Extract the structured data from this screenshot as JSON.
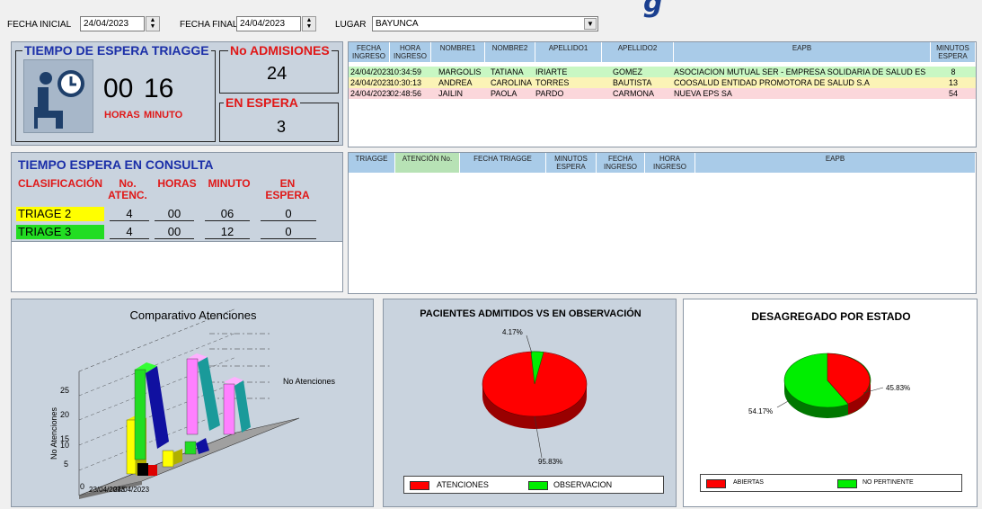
{
  "filters": {
    "fecha_inicial_label": "FECHA INICIAL",
    "fecha_inicial_value": "24/04/2023",
    "fecha_final_label": "FECHA FINAL",
    "fecha_final_value": "24/04/2023",
    "lugar_label": "LUGAR",
    "lugar_value": "BAYUNCA"
  },
  "wait_triage": {
    "title": "TIEMPO DE ESPERA TRIAGGE",
    "hours": "00",
    "minutes": "16",
    "hours_label": "HORAS",
    "minutes_label": "MINUTO"
  },
  "admissions": {
    "title": "No ADMISIONES",
    "value": "24"
  },
  "waiting": {
    "title": "EN ESPERA",
    "value": "3"
  },
  "waiting_table": {
    "headers": [
      "FECHA INGRESO",
      "HORA INGRESO",
      "NOMBRE1",
      "NOMBRE2",
      "APELLIDO1",
      "APELLIDO2",
      "EAPB",
      "MINUTOS ESPERA"
    ],
    "rows": [
      {
        "fecha": "24/04/2023",
        "hora": "10:34:59",
        "nombre1": "MARGOLIS",
        "nombre2": "TATIANA",
        "apellido1": "IRIARTE",
        "apellido2": "GOMEZ",
        "eapb": "ASOCIACION MUTUAL SER - EMPRESA SOLIDARIA DE SALUD ES",
        "minutos": "8",
        "color": "#c8f7c3"
      },
      {
        "fecha": "24/04/2023",
        "hora": "10:30:13",
        "nombre1": "ANDREA",
        "nombre2": "CAROLINA",
        "apellido1": "TORRES",
        "apellido2": "BAUTISTA",
        "eapb": "COOSALUD ENTIDAD PROMOTORA DE SALUD S.A",
        "minutos": "13",
        "color": "#fbf3b6"
      },
      {
        "fecha": "24/04/2023",
        "hora": "02:48:56",
        "nombre1": "JAILIN",
        "nombre2": "PAOLA",
        "apellido1": "PARDO",
        "apellido2": "CARMONA",
        "eapb": "NUEVA EPS SA",
        "minutos": "54",
        "color": "#fbd7db"
      }
    ]
  },
  "consult": {
    "title": "TIEMPO ESPERA EN CONSULTA",
    "headers": [
      "CLASIFICACIÓN",
      "No. ATENC.",
      "HORAS",
      "MINUTO",
      "EN ESPERA"
    ],
    "rows": [
      {
        "name": "TRIAGE 2",
        "aten": "4",
        "horas": "00",
        "minuto": "06",
        "espera": "0",
        "color": "#ffff00"
      },
      {
        "name": "TRIAGE 3",
        "aten": "4",
        "horas": "00",
        "minuto": "12",
        "espera": "0",
        "color": "#22dd22"
      }
    ]
  },
  "attention_table": {
    "headers": [
      "TRIAGGE",
      "ATENCIÓN No.",
      "FECHA TRIAGGE",
      "MINUTOS ESPERA",
      "FECHA INGRESO",
      "HORA INGRESO",
      "EAPB"
    ]
  },
  "chart_data": [
    {
      "type": "bar",
      "title": "Comparativo Atenciones",
      "ylabel": "No Atenciones",
      "legend": "No Atenciones",
      "categories": [
        "23/04/2023",
        "24/04/2023"
      ],
      "y_ticks": [
        "0",
        "5",
        "10",
        "15",
        "20",
        "25"
      ],
      "ylim": [
        0,
        25
      ],
      "series_colors": [
        "#ffff00",
        "#22dd22",
        "#ff80ff",
        "#ff80ff",
        "#000000",
        "#1010a0",
        "#1a9a9a"
      ]
    },
    {
      "type": "pie",
      "title": "PACIENTES ADMITIDOS VS EN OBSERVACIÓN",
      "slices": [
        {
          "label": "ATENCIONES",
          "value": 95.83,
          "text": "95.83%",
          "color": "#ff0000"
        },
        {
          "label": "OBSERVACION",
          "value": 4.17,
          "text": "4.17%",
          "color": "#00ee00"
        }
      ]
    },
    {
      "type": "pie",
      "title": "DESAGREGADO POR ESTADO",
      "slices": [
        {
          "label": "ABIERTAS",
          "value": 45.83,
          "text": "45.83%",
          "color": "#ff0000"
        },
        {
          "label": "NO PERTINENTE",
          "value": 54.17,
          "text": "54.17%",
          "color": "#00ee00"
        }
      ]
    }
  ]
}
